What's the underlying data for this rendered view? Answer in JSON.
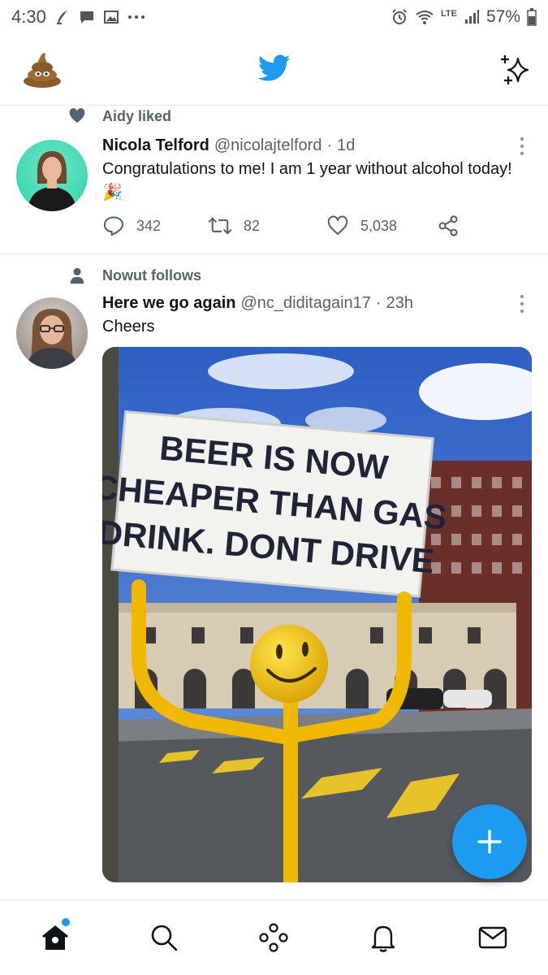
{
  "status_bar": {
    "time": "4:30",
    "network": "LTE",
    "battery": "57%",
    "icons": [
      "quill-icon",
      "message-icon",
      "gallery-icon",
      "more-dots-icon",
      "alarm-icon",
      "wifi-icon",
      "signal-icon",
      "battery-icon"
    ]
  },
  "top_bar": {
    "brand_color": "#1d9bf0",
    "icons": [
      "profile-avatar-icon",
      "twitter-bird-icon",
      "sparkle-icon"
    ]
  },
  "tweets": [
    {
      "context": "Aidy liked",
      "context_icon": "heart-icon",
      "name": "Nicola Telford",
      "handle": "@nicolajtelford",
      "separator": "·",
      "time": "1d",
      "text": "Congratulations to me! I am 1 year without alcohol today!",
      "emoji": "🎉",
      "replies": "342",
      "retweets": "82",
      "likes": "5,038"
    },
    {
      "context": "Nowut follows",
      "context_icon": "person-icon",
      "name": "Here we go again",
      "handle": "@nc_diditagain17",
      "separator": "·",
      "time": "23h",
      "text": "Cheers",
      "image": {
        "sign_lines": [
          "BEER IS NOW",
          "CHEAPER THAN GAS",
          "DRINK. DONT DRIVE"
        ]
      }
    }
  ],
  "compose": {
    "label": "+"
  },
  "bottom_nav": {
    "items": [
      "home-icon",
      "search-icon",
      "spaces-icon",
      "notifications-icon",
      "messages-icon"
    ]
  }
}
